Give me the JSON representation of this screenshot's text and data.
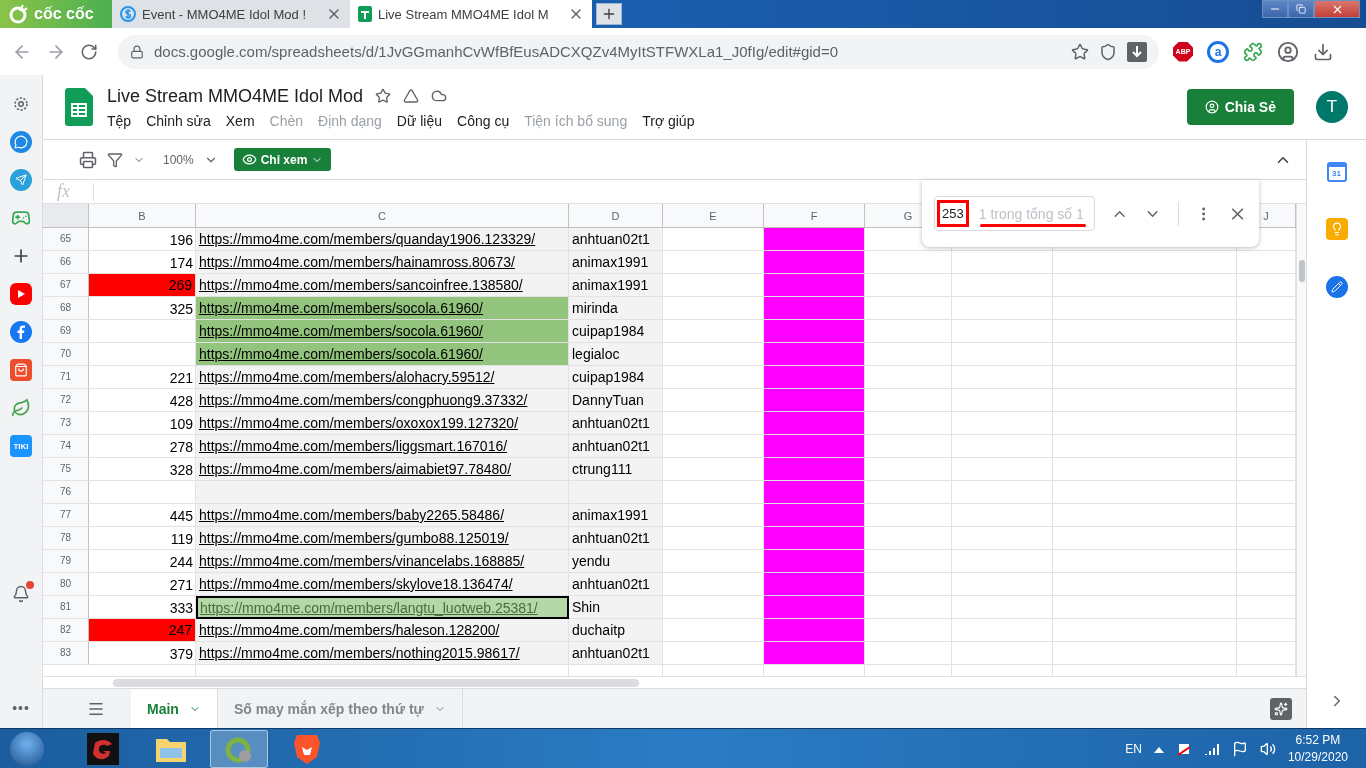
{
  "browser": {
    "brand": "cốc cốc",
    "tabs": [
      {
        "title": "Event - MMO4ME Idol Mod !",
        "selected": false
      },
      {
        "title": "Live Stream MMO4ME Idol M",
        "selected": true
      }
    ],
    "url": "docs.google.com/spreadsheets/d/1JvGGmanhCvWfBfEusADCXQZv4MyItSTFWXLa1_J0fIg/edit#gid=0",
    "abp": "ABP",
    "ext_letter": "a"
  },
  "sidebar": {
    "items": [
      {
        "kind": "settings"
      },
      {
        "kind": "messenger"
      },
      {
        "kind": "telegram"
      },
      {
        "kind": "game"
      },
      {
        "kind": "add"
      },
      {
        "kind": "youtube"
      },
      {
        "kind": "facebook"
      },
      {
        "kind": "shop"
      },
      {
        "kind": "leaf"
      },
      {
        "kind": "tiki",
        "label": "TIKI"
      }
    ],
    "bell_badge": true,
    "more": "•••"
  },
  "sheet": {
    "title": "Live Stream MMO4ME Idol Mod",
    "menu": [
      {
        "label": "Tệp",
        "disabled": false
      },
      {
        "label": "Chỉnh sửa",
        "disabled": false
      },
      {
        "label": "Xem",
        "disabled": false
      },
      {
        "label": "Chèn",
        "disabled": true
      },
      {
        "label": "Định dạng",
        "disabled": true
      },
      {
        "label": "Dữ liệu",
        "disabled": false
      },
      {
        "label": "Công cụ",
        "disabled": false
      },
      {
        "label": "Tiện ích bổ sung",
        "disabled": true
      },
      {
        "label": "Trợ giúp",
        "disabled": false
      }
    ],
    "share": "Chia Sẻ",
    "avatar": "T",
    "zoom": "100%",
    "mode": "Chỉ xem",
    "formula_label": "fx",
    "columns": [
      {
        "label": "B"
      },
      {
        "label": "C"
      },
      {
        "label": "D"
      },
      {
        "label": "E"
      },
      {
        "label": "F",
        "color": "#ff00ff"
      },
      {
        "label": "G"
      },
      {
        "label": "J"
      }
    ],
    "rows": [
      {
        "row": "65",
        "b": {
          "text": "196"
        },
        "c": {
          "text": "https://mmo4me.com/members/quanday1906.123329/"
        },
        "d": {
          "text": "anhtuan02t1"
        },
        "selected": false
      },
      {
        "row": "66",
        "b": {
          "text": "174"
        },
        "c": {
          "text": "https://mmo4me.com/members/hainamross.80673/"
        },
        "d": {
          "text": "animax1991"
        },
        "selected": false
      },
      {
        "row": "67",
        "b": {
          "text": "269",
          "color": "#ff0000"
        },
        "c": {
          "text": "https://mmo4me.com/members/sancoinfree.138580/"
        },
        "d": {
          "text": "animax1991"
        },
        "selected": false
      },
      {
        "row": "68",
        "b": {
          "text": "325"
        },
        "c": {
          "text": "https://mmo4me.com/members/socola.61960/",
          "color": "#93c47d"
        },
        "d": {
          "text": "mirinda"
        },
        "selected": false
      },
      {
        "row": "69",
        "c": {
          "text": "https://mmo4me.com/members/socola.61960/",
          "color": "#93c47d"
        },
        "d": {
          "text": "cuipap1984"
        },
        "selected": false
      },
      {
        "row": "70",
        "c": {
          "text": "https://mmo4me.com/members/socola.61960/",
          "color": "#93c47d"
        },
        "d": {
          "text": "legialoc"
        },
        "selected": false
      },
      {
        "row": "71",
        "b": {
          "text": "221"
        },
        "c": {
          "text": "https://mmo4me.com/members/alohacry.59512/"
        },
        "d": {
          "text": "cuipap1984"
        },
        "selected": false
      },
      {
        "row": "72",
        "b": {
          "text": "428"
        },
        "c": {
          "text": "https://mmo4me.com/members/congphuong9.37332/"
        },
        "d": {
          "text": "DannyTuan"
        },
        "selected": false
      },
      {
        "row": "73",
        "b": {
          "text": "109"
        },
        "c": {
          "text": "https://mmo4me.com/members/oxoxox199.127320/"
        },
        "d": {
          "text": "anhtuan02t1"
        },
        "selected": false
      },
      {
        "row": "74",
        "b": {
          "text": "278"
        },
        "c": {
          "text": "https://mmo4me.com/members/liggsmart.167016/"
        },
        "d": {
          "text": "anhtuan02t1"
        },
        "selected": false
      },
      {
        "row": "75",
        "b": {
          "text": "328"
        },
        "c": {
          "text": "https://mmo4me.com/members/aimabiet97.78480/"
        },
        "d": {
          "text": "ctrung111"
        },
        "selected": false
      },
      {
        "row": "76",
        "selected": false
      },
      {
        "row": "77",
        "b": {
          "text": "445"
        },
        "c": {
          "text": "https://mmo4me.com/members/baby2265.58486/"
        },
        "d": {
          "text": "animax1991"
        },
        "selected": false
      },
      {
        "row": "78",
        "b": {
          "text": "119"
        },
        "c": {
          "text": "https://mmo4me.com/members/gumbo88.125019/"
        },
        "d": {
          "text": "anhtuan02t1"
        },
        "selected": false
      },
      {
        "row": "79",
        "b": {
          "text": "244"
        },
        "c": {
          "text": "https://mmo4me.com/members/vinancelabs.168885/"
        },
        "d": {
          "text": "yendu"
        },
        "selected": false
      },
      {
        "row": "80",
        "b": {
          "text": "271"
        },
        "c": {
          "text": "https://mmo4me.com/members/skylove18.136474/"
        },
        "d": {
          "text": "anhtuan02t1"
        },
        "selected": false
      },
      {
        "row": "81",
        "b": {
          "text": "333"
        },
        "c": {
          "text": "https://mmo4me.com/members/langtu_luotweb.25381/",
          "color": "#b6d7a8"
        },
        "d": {
          "text": "Shin"
        },
        "selected": true
      },
      {
        "row": "82",
        "b": {
          "text": "247",
          "color": "#ff0000"
        },
        "c": {
          "text": "https://mmo4me.com/members/haleson.128200/"
        },
        "d": {
          "text": "duchaitp"
        },
        "selected": false
      },
      {
        "row": "83",
        "b": {
          "text": "379"
        },
        "c": {
          "text": "https://mmo4me.com/members/nothing2015.98617/"
        },
        "d": {
          "text": "anhtuan02t1"
        },
        "selected": false
      }
    ],
    "find": {
      "query": "253",
      "result": "1 trong tổng số 1"
    },
    "tabs": [
      {
        "label": "Main",
        "selected": true
      },
      {
        "label": "Số may mắn xếp theo thứ tự",
        "selected": false
      }
    ]
  },
  "side_panel": {
    "calendar_day": "31"
  },
  "taskbar": {
    "lang": "EN",
    "time": "6:52 PM",
    "date": "10/29/2020"
  }
}
